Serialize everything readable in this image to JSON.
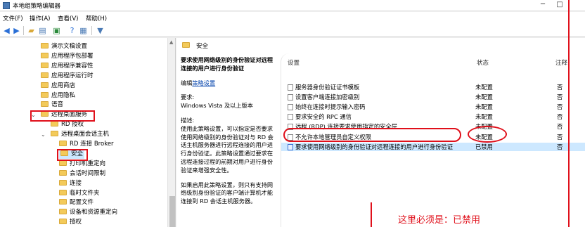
{
  "window": {
    "title": "本地组策略编辑器",
    "min": "─",
    "max": "□"
  },
  "menu": [
    "文件(F)",
    "操作(A)",
    "查看(V)",
    "帮助(H)"
  ],
  "tree": {
    "items": [
      {
        "label": "演示文稿设置",
        "indent": 1
      },
      {
        "label": "应用程序包部署",
        "indent": 1
      },
      {
        "label": "应用程序兼容性",
        "indent": 1
      },
      {
        "label": "应用程序运行时",
        "indent": 1
      },
      {
        "label": "应用商店",
        "indent": 1
      },
      {
        "label": "应用隐私",
        "indent": 1
      },
      {
        "label": "语音",
        "indent": 1
      },
      {
        "label": "远程桌面服务",
        "indent": 1,
        "expanded": true
      },
      {
        "label": "RD 授权",
        "indent": 2
      },
      {
        "label": "远程桌面会话主机",
        "indent": 2,
        "expanded": true
      },
      {
        "label": "RD 连接 Broker",
        "indent": 3
      },
      {
        "label": "安全",
        "indent": 3,
        "selected": true
      },
      {
        "label": "打印机重定向",
        "indent": 3
      },
      {
        "label": "会话时间限制",
        "indent": 3
      },
      {
        "label": "连接",
        "indent": 3
      },
      {
        "label": "临时文件夹",
        "indent": 3
      },
      {
        "label": "配置文件",
        "indent": 3
      },
      {
        "label": "设备和资源重定向",
        "indent": 3
      },
      {
        "label": "授权",
        "indent": 3
      }
    ]
  },
  "right": {
    "folder": "安全",
    "desc": {
      "title": "要求使用网络级别的身份验证对远程连接的用户进行身份验证",
      "edit_prefix": "编辑",
      "edit_link": "策略设置",
      "req_label": "要求:",
      "req_value": "Windows Vista 及以上版本",
      "desc_label": "描述:",
      "desc_text": "使用此策略设置，可以指定是否要求使用网络级别的身份验证对与 RD 会话主机服务器进行远程连接的用户进行身份验证。此策略设置通过要求在远程连接过程的前期对用户进行身份验证来增强安全性。",
      "desc_text2": "如果启用此策略设置，则只有支持网络级别身份验证的客户端计算机才能连接到 RD 会话主机服务器。"
    },
    "columns": {
      "setting": "设置",
      "state": "状态",
      "comment": "注释"
    },
    "rows": [
      {
        "name": "服务器身份验证证书模板",
        "state": "未配置",
        "comment": "否"
      },
      {
        "name": "设置客户端连接加密级别",
        "state": "未配置",
        "comment": "否"
      },
      {
        "name": "始终在连接时提示输入密码",
        "state": "未配置",
        "comment": "否"
      },
      {
        "name": "要求安全的 RPC 通信",
        "state": "未配置",
        "comment": "否"
      },
      {
        "name": "远程 (RDP) 连接要求使用指定的安全层",
        "state": "未配置",
        "comment": "否"
      },
      {
        "name": "不允许本地管理员自定义权限",
        "state": "未配置",
        "comment": "否"
      },
      {
        "name": "要求使用网络级别的身份验证对远程连接的用户进行身份验证",
        "state": "已禁用",
        "comment": "否",
        "selected": true
      }
    ]
  },
  "annotation": {
    "note": "这里必须是：已禁用",
    "color": "#e0101b"
  }
}
